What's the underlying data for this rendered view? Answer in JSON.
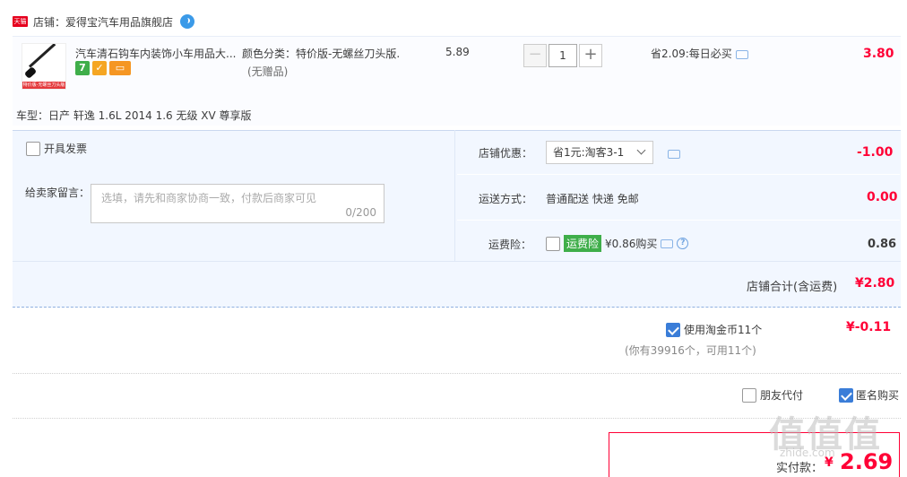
{
  "shop": {
    "badge": "天猫",
    "name": "店铺：爱得宝汽车用品旗舰店"
  },
  "item": {
    "thumb_caption": "特价版-无螺丝刀头版",
    "title": "汽车清石钩车内装饰小车用品大...",
    "sku": "颜色分类：特价版-无螺丝刀头版.",
    "gift": "(无赠品)",
    "unit_price": "5.89",
    "quantity": "1",
    "minus": "−",
    "plus": "+",
    "save_note": "省2.09:每日必买",
    "total": "3.80",
    "icon7": "7"
  },
  "car_model": "车型：日产 轩逸 1.6L 2014 1.6 无级 XV 尊享版",
  "invoice_label": "开具发票",
  "message": {
    "label": "给卖家留言：",
    "placeholder": "选填，请先和商家协商一致，付款后商家可见",
    "count": "0/200"
  },
  "shop_discount": {
    "label": "店铺优惠：",
    "selected": "省1元:淘客3-1",
    "value": "-1.00"
  },
  "shipping": {
    "label": "运送方式：",
    "value": "普通配送 快递 免邮",
    "cost": "0.00"
  },
  "insurance": {
    "label": "运费险：",
    "badge": "运费险",
    "text": "¥0.86购买",
    "price": "0.86",
    "help": "?"
  },
  "shop_total": {
    "label": "店铺合计(含运费)",
    "value": "¥2.80"
  },
  "coins": {
    "label": "使用淘金币11个",
    "value": "¥-0.11",
    "note": "(你有39916个，可用11个)"
  },
  "friend_pay": "朋友代付",
  "anonymous": "匿名购买",
  "payment": {
    "label": "实付款：",
    "currency": "¥",
    "value": "2.69"
  },
  "watermark": {
    "main": "值值值",
    "sub": "zhide.com"
  },
  "colors": {
    "price_red": "#ff0036",
    "panel_bg": "#f2f7ff",
    "accent_blue": "#3a7dd8"
  }
}
